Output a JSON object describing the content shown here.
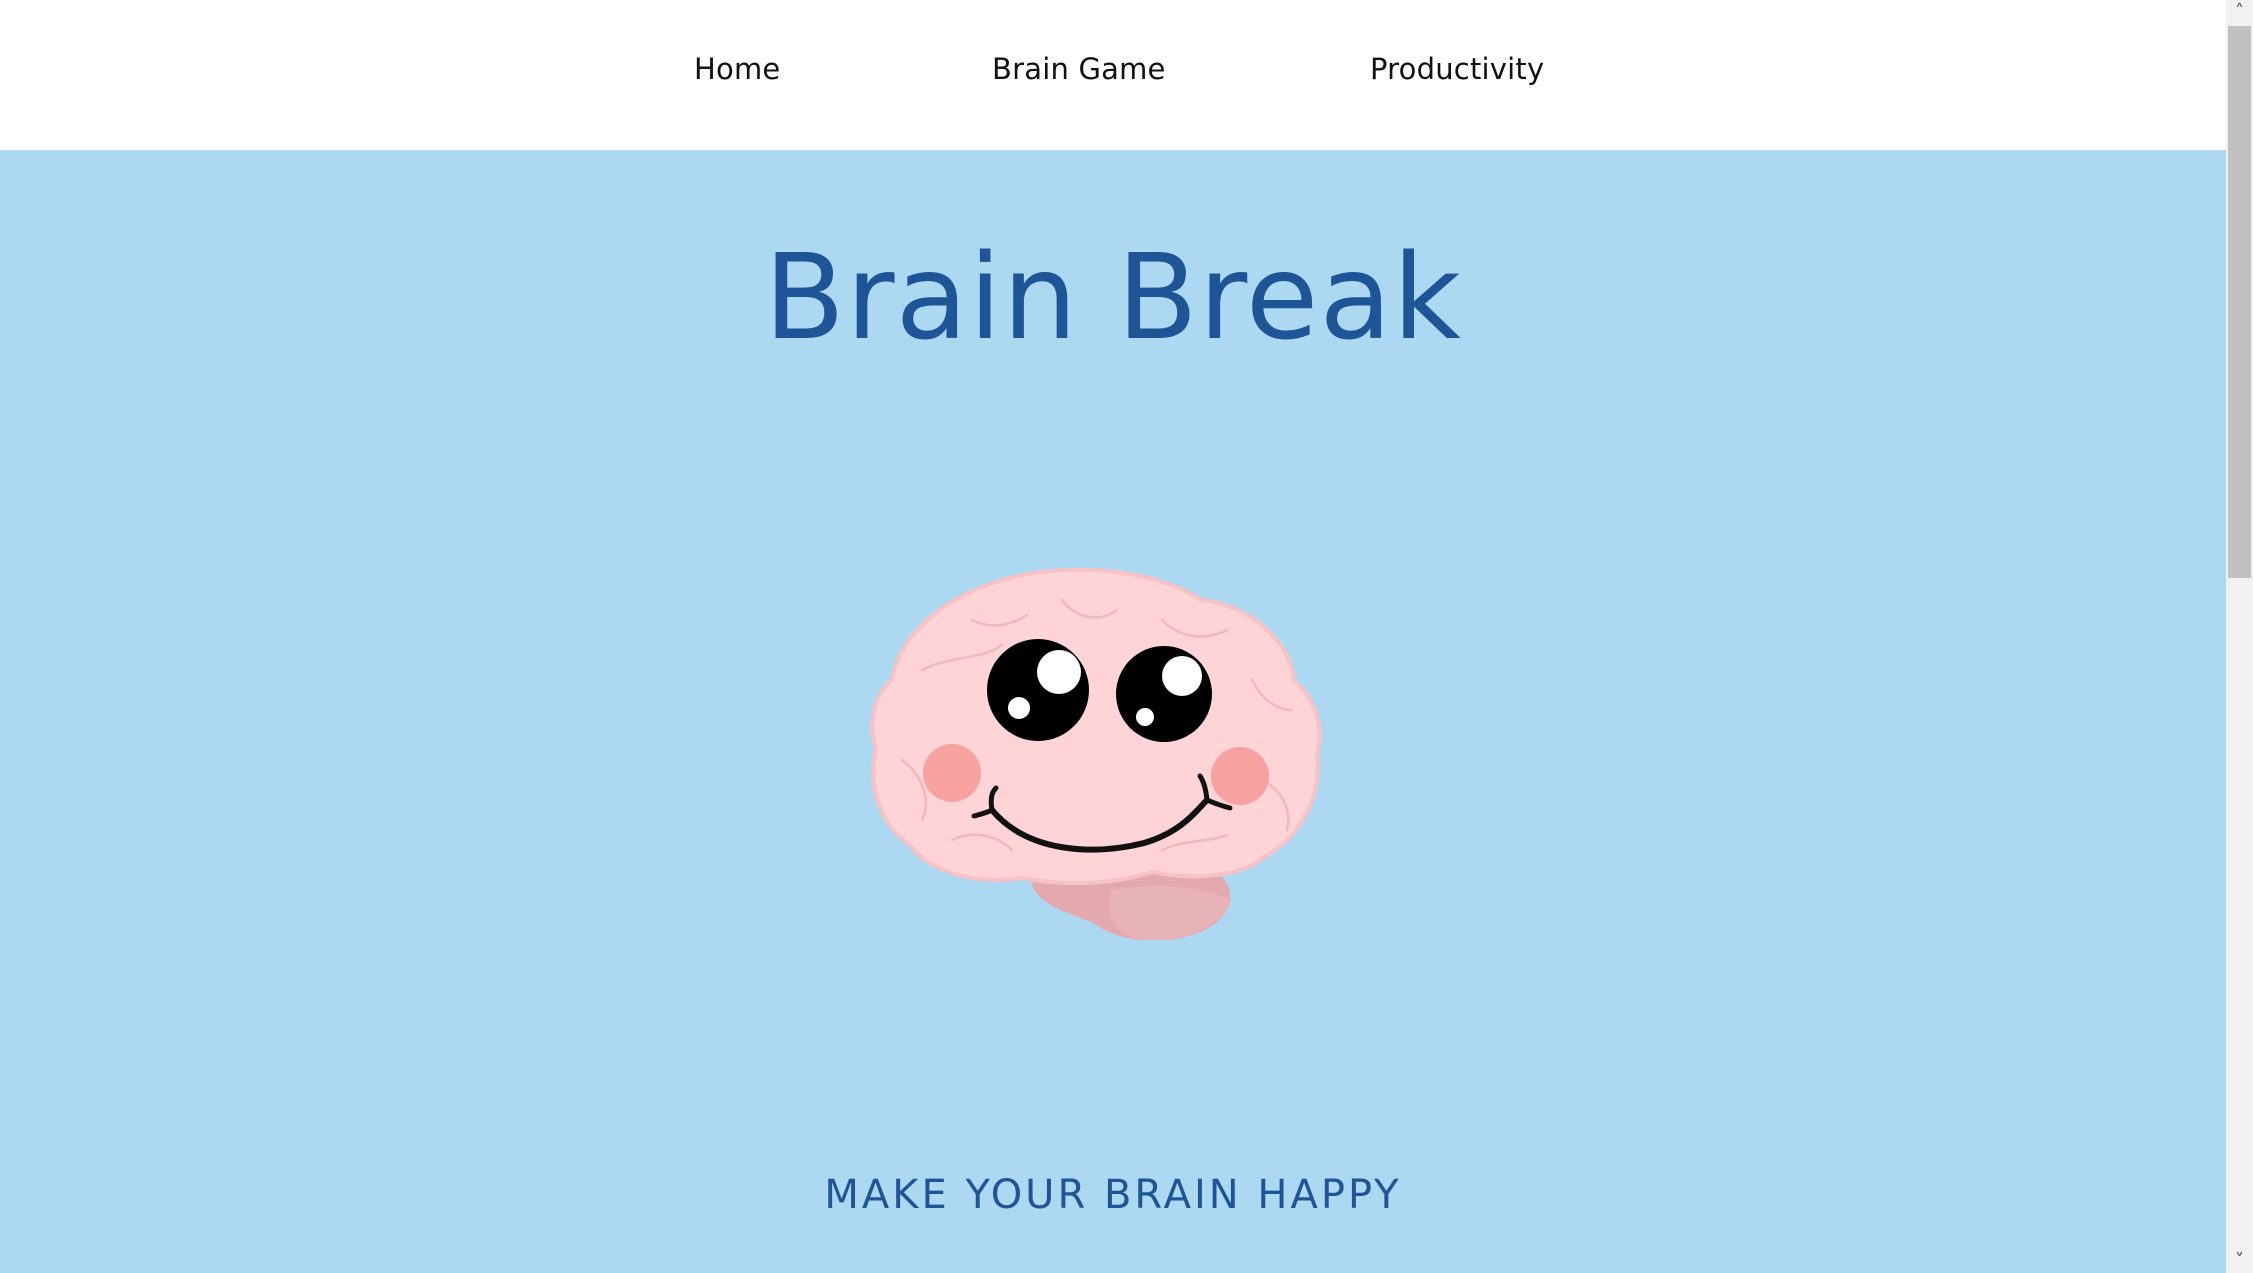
{
  "nav": {
    "items": [
      {
        "label": "Home"
      },
      {
        "label": "Brain Game"
      },
      {
        "label": "Productivity"
      }
    ]
  },
  "hero": {
    "title": "Brain Break",
    "mascot_icon": "smiling-brain-icon",
    "tagline": "MAKE YOUR BRAIN HAPPY"
  },
  "colors": {
    "hero_background": "#add8f2",
    "title": "#1e5597",
    "brain": "#ffd4d6",
    "cheeks": "#f7a1a1"
  },
  "scrollbar": {
    "up_icon": "chevron-up-icon",
    "down_icon": "chevron-down-icon"
  }
}
